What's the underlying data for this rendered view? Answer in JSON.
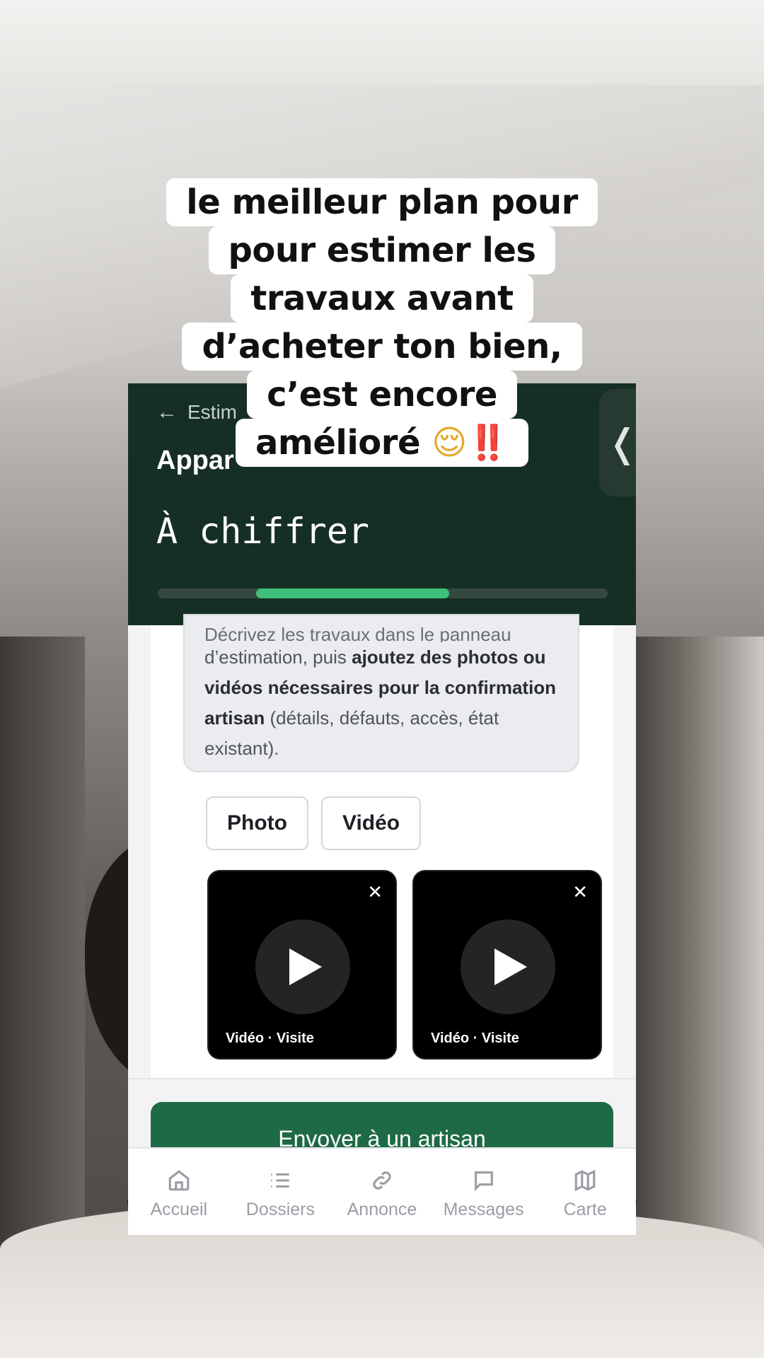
{
  "caption": {
    "lines": [
      "le meilleur plan pour",
      "pour estimer les",
      "travaux avant",
      "d’acheter ton bien,",
      "c’est encore",
      "amélioré"
    ],
    "emoji_face": "😌",
    "emoji_bang": "‼️"
  },
  "app": {
    "back_label": "Estim",
    "property_title": "Appar",
    "status_title": "À chiffrer",
    "progress_fraction": 0.43,
    "side_handle_icon": "chevron-left-icon",
    "info": {
      "cut_text": "Décrivez les travaux dans le panneau",
      "text_1": "d’estimation, puis ",
      "bold_1": "ajoutez des photos ou vidéos nécessaires pour la confirmation artisan",
      "text_2": " (détails, défauts, accès, état existant)."
    },
    "media_buttons": [
      "Photo",
      "Vidéo"
    ],
    "videos": [
      {
        "label": "Vidéo · Visite",
        "close": "✕"
      },
      {
        "label": "Vidéo · Visite",
        "close": "✕"
      }
    ],
    "cta_label": "Envoyer à un artisan",
    "nav": [
      {
        "label": "Accueil",
        "icon": "home-icon"
      },
      {
        "label": "Dossiers",
        "icon": "list-icon"
      },
      {
        "label": "Annonce",
        "icon": "link-icon"
      },
      {
        "label": "Messages",
        "icon": "message-icon"
      },
      {
        "label": "Carte",
        "icon": "map-icon"
      }
    ]
  },
  "colors": {
    "header_bg": "#162f25",
    "progress": "#3fc07a",
    "cta": "#1f6a46"
  }
}
